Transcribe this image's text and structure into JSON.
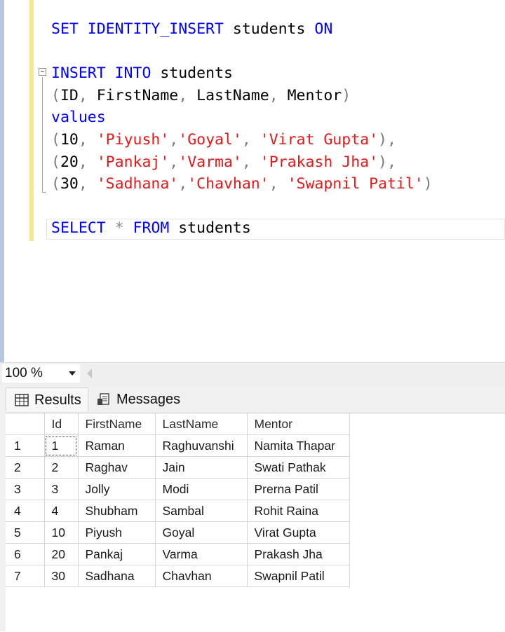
{
  "editor": {
    "lines": [
      [
        {
          "t": "SET IDENTITY_INSERT ",
          "c": "kw"
        },
        {
          "t": "students ",
          "c": "id"
        },
        {
          "t": "ON",
          "c": "kw"
        }
      ],
      [],
      [
        {
          "t": "INSERT INTO ",
          "c": "kw"
        },
        {
          "t": "students",
          "c": "id"
        }
      ],
      [
        {
          "t": "(",
          "c": "pun"
        },
        {
          "t": "ID",
          "c": "id"
        },
        {
          "t": ", ",
          "c": "pun"
        },
        {
          "t": "FirstName",
          "c": "id"
        },
        {
          "t": ", ",
          "c": "pun"
        },
        {
          "t": "LastName",
          "c": "id"
        },
        {
          "t": ", ",
          "c": "pun"
        },
        {
          "t": "Mentor",
          "c": "id"
        },
        {
          "t": ")",
          "c": "pun"
        }
      ],
      [
        {
          "t": "values",
          "c": "kw"
        }
      ],
      [
        {
          "t": "(",
          "c": "pun"
        },
        {
          "t": "10",
          "c": "id"
        },
        {
          "t": ", ",
          "c": "pun"
        },
        {
          "t": "'Piyush'",
          "c": "str"
        },
        {
          "t": ",",
          "c": "pun"
        },
        {
          "t": "'Goyal'",
          "c": "str"
        },
        {
          "t": ", ",
          "c": "pun"
        },
        {
          "t": "'Virat Gupta'",
          "c": "str"
        },
        {
          "t": "),",
          "c": "pun"
        }
      ],
      [
        {
          "t": "(",
          "c": "pun"
        },
        {
          "t": "20",
          "c": "id"
        },
        {
          "t": ", ",
          "c": "pun"
        },
        {
          "t": "'Pankaj'",
          "c": "str"
        },
        {
          "t": ",",
          "c": "pun"
        },
        {
          "t": "'Varma'",
          "c": "str"
        },
        {
          "t": ", ",
          "c": "pun"
        },
        {
          "t": "'Prakash Jha'",
          "c": "str"
        },
        {
          "t": "),",
          "c": "pun"
        }
      ],
      [
        {
          "t": "(",
          "c": "pun"
        },
        {
          "t": "30",
          "c": "id"
        },
        {
          "t": ", ",
          "c": "pun"
        },
        {
          "t": "'Sadhana'",
          "c": "str"
        },
        {
          "t": ",",
          "c": "pun"
        },
        {
          "t": "'Chavhan'",
          "c": "str"
        },
        {
          "t": ", ",
          "c": "pun"
        },
        {
          "t": "'Swapnil Patil'",
          "c": "str"
        },
        {
          "t": ")",
          "c": "pun"
        }
      ],
      [],
      [
        {
          "t": "SELECT ",
          "c": "kw"
        },
        {
          "t": "* ",
          "c": "op"
        },
        {
          "t": "FROM ",
          "c": "kw"
        },
        {
          "t": "students",
          "c": "id"
        }
      ]
    ]
  },
  "status_bar": {
    "zoom": "100 %"
  },
  "tabs": {
    "results": {
      "label": "Results",
      "icon": "grid-icon"
    },
    "messages": {
      "label": "Messages",
      "icon": "messages-icon"
    }
  },
  "grid": {
    "columns": [
      "Id",
      "FirstName",
      "LastName",
      "Mentor"
    ],
    "rows": [
      [
        "1",
        "1",
        "Raman",
        "Raghuvanshi",
        "Namita Thapar"
      ],
      [
        "2",
        "2",
        "Raghav",
        "Jain",
        "Swati Pathak"
      ],
      [
        "3",
        "3",
        "Jolly",
        "Modi",
        "Prerna Patil"
      ],
      [
        "4",
        "4",
        "Shubham",
        "Sambal",
        "Rohit Raina"
      ],
      [
        "5",
        "10",
        "Piyush",
        "Goyal",
        "Virat Gupta"
      ],
      [
        "6",
        "20",
        "Pankaj",
        "Varma",
        "Prakash Jha"
      ],
      [
        "7",
        "30",
        "Sadhana",
        "Chavhan",
        "Swapnil Patil"
      ]
    ]
  },
  "colors": {
    "keyword": "#0000ff",
    "string": "#e11a1a",
    "margin_marker": "#f4e98c"
  }
}
